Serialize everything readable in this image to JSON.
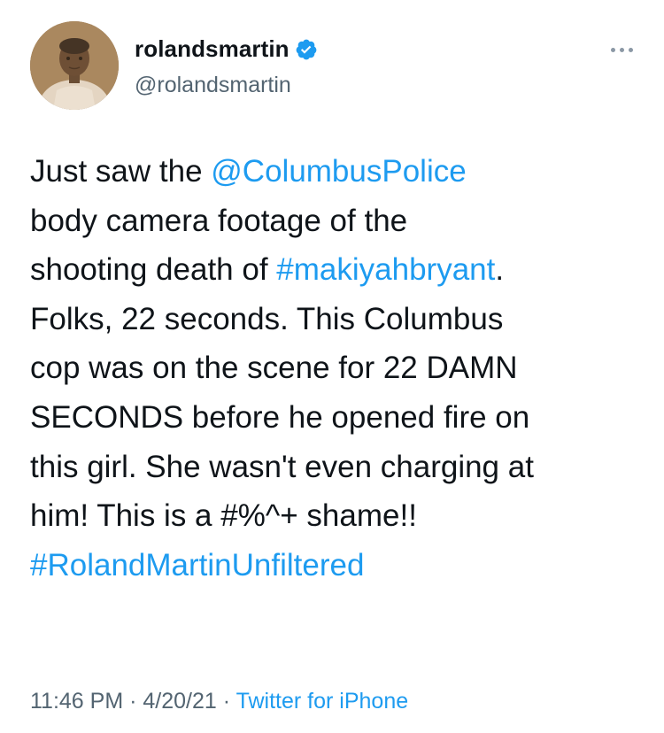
{
  "profile": {
    "display_name": "rolandsmartin",
    "handle": "@rolandsmartin",
    "avatar_icon": "child-portrait-avatar",
    "verified_icon": "verified-badge-icon"
  },
  "more_menu_icon": "more-horizontal-icon",
  "tweet": {
    "lines": [
      [
        {
          "text": "Just saw the ",
          "link": false
        },
        {
          "text": "@ColumbusPolice",
          "link": true
        }
      ],
      [
        {
          "text": "body camera footage of the",
          "link": false
        }
      ],
      [
        {
          "text": "shooting death of ",
          "link": false
        },
        {
          "text": "#makiyahbryant",
          "link": true
        },
        {
          "text": ".",
          "link": false
        }
      ],
      [
        {
          "text": "Folks, 22 seconds. This Columbus",
          "link": false
        }
      ],
      [
        {
          "text": "cop was on the scene for 22 DAMN",
          "link": false
        }
      ],
      [
        {
          "text": "SECONDS before he opened fire on",
          "link": false
        }
      ],
      [
        {
          "text": "this girl. She wasn't even charging at",
          "link": false
        }
      ],
      [
        {
          "text": "him! This is a #%^+ shame!!",
          "link": false
        }
      ],
      [
        {
          "text": "#RolandMartinUnfiltered",
          "link": true
        }
      ]
    ]
  },
  "meta": {
    "time": "11:46 PM",
    "separator": "·",
    "date": "4/20/21",
    "source": "Twitter for iPhone"
  },
  "colors": {
    "link": "#1d9bf0",
    "text": "#0f1419",
    "secondary": "#536471",
    "verified": "#1d9bf0"
  }
}
